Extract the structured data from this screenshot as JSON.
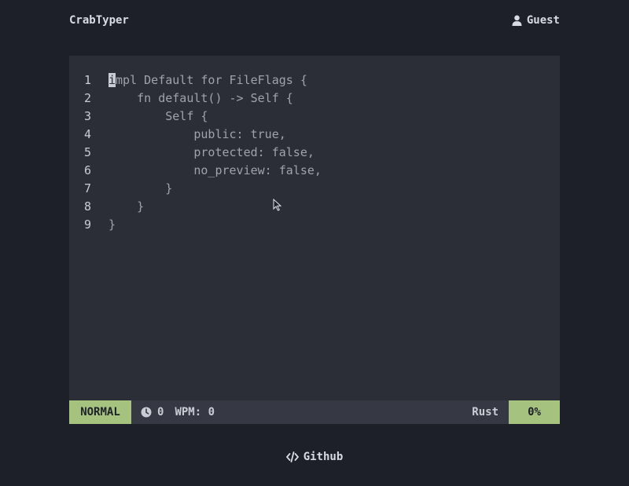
{
  "header": {
    "brand": "CrabTyper",
    "user_label": "Guest"
  },
  "editor": {
    "cursor_char": "i",
    "first_line_rest": "mpl Default for FileFlags {",
    "lines": [
      {
        "num": "1",
        "text": "impl Default for FileFlags {"
      },
      {
        "num": "2",
        "text": "    fn default() -> Self {"
      },
      {
        "num": "3",
        "text": "        Self {"
      },
      {
        "num": "4",
        "text": "            public: true,"
      },
      {
        "num": "5",
        "text": "            protected: false,"
      },
      {
        "num": "6",
        "text": "            no_preview: false,"
      },
      {
        "num": "7",
        "text": "        }"
      },
      {
        "num": "8",
        "text": "    }"
      },
      {
        "num": "9",
        "text": "}"
      }
    ]
  },
  "statusbar": {
    "mode": "NORMAL",
    "timer_value": "0",
    "wpm_text": "WPM: 0",
    "language": "Rust",
    "progress": "0%"
  },
  "footer": {
    "github_label": "Github"
  },
  "colors": {
    "background": "#1e2029",
    "editor_bg": "#2b2e37",
    "statusbar_bg": "#363944",
    "accent_green": "#a5c27f"
  }
}
